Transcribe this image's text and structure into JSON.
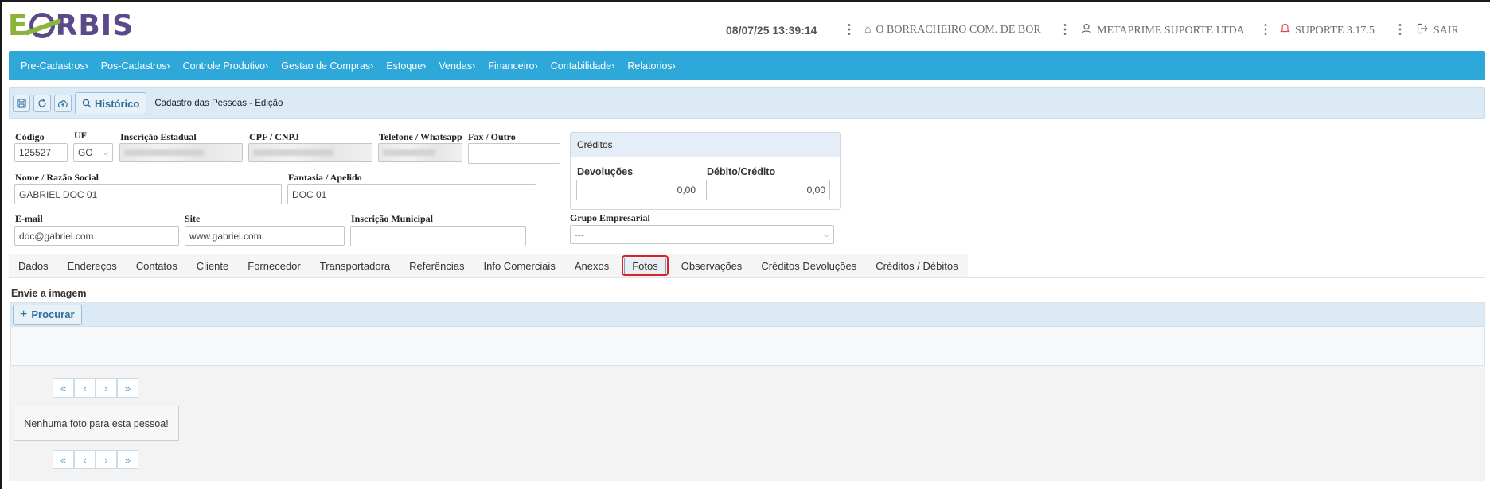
{
  "header": {
    "logo_e": "E",
    "logo_rest": "RBIS",
    "datetime": "08/07/25 13:39:14",
    "company": "O BORRACHEIRO COM. DE BOR",
    "user": "METAPRIME SUPORTE LTDA",
    "support": "SUPORTE 3.17.5",
    "logout": "SAIR"
  },
  "menu": [
    "Pre-Cadastros›",
    "Pos-Cadastros›",
    "Controle Produtivo›",
    "Gestao de Compras›",
    "Estoque›",
    "Vendas›",
    "Financeiro›",
    "Contabilidade›",
    "Relatorios›"
  ],
  "toolbar": {
    "historico": "Histórico",
    "title": "Cadastro das Pessoas - Edição"
  },
  "form": {
    "codigo_label": "Código",
    "codigo_value": "125527",
    "uf_label": "UF",
    "uf_value": "GO",
    "ie_label": "Inscrição Estadual",
    "cpf_label": "CPF / CNPJ",
    "telefone_label": "Telefone / Whatsapp",
    "fax_label": "Fax / Outro",
    "nome_label": "Nome / Razão Social",
    "nome_value": "GABRIEL DOC 01",
    "fantasia_label": "Fantasia / Apelido",
    "fantasia_value": "DOC 01",
    "email_label": "E-mail",
    "email_value": "doc@gabriel.com",
    "site_label": "Site",
    "site_value": "www.gabriel.com",
    "im_label": "Inscrição Municipal",
    "grupo_label": "Grupo Empresarial",
    "grupo_value": "---"
  },
  "creditos": {
    "title": "Créditos",
    "devolucoes_label": "Devoluções",
    "devolucoes_value": "0,00",
    "debito_label": "Débito/Crédito",
    "debito_value": "0,00"
  },
  "tabs": [
    "Dados",
    "Endereços",
    "Contatos",
    "Cliente",
    "Fornecedor",
    "Transportadora",
    "Referências",
    "Info Comerciais",
    "Anexos",
    "Fotos",
    "Observações",
    "Créditos Devoluções",
    "Créditos / Débitos"
  ],
  "active_tab": "Fotos",
  "fotos": {
    "upload_label": "Envie a imagem",
    "procurar": "Procurar",
    "empty_message": "Nenhuma foto para esta pessoa!"
  },
  "colors": {
    "menubar": "#2ea8d8",
    "logo_green": "#8bb43c",
    "logo_purple": "#5a4a8a",
    "active_tab_highlight": "#d9232a"
  }
}
